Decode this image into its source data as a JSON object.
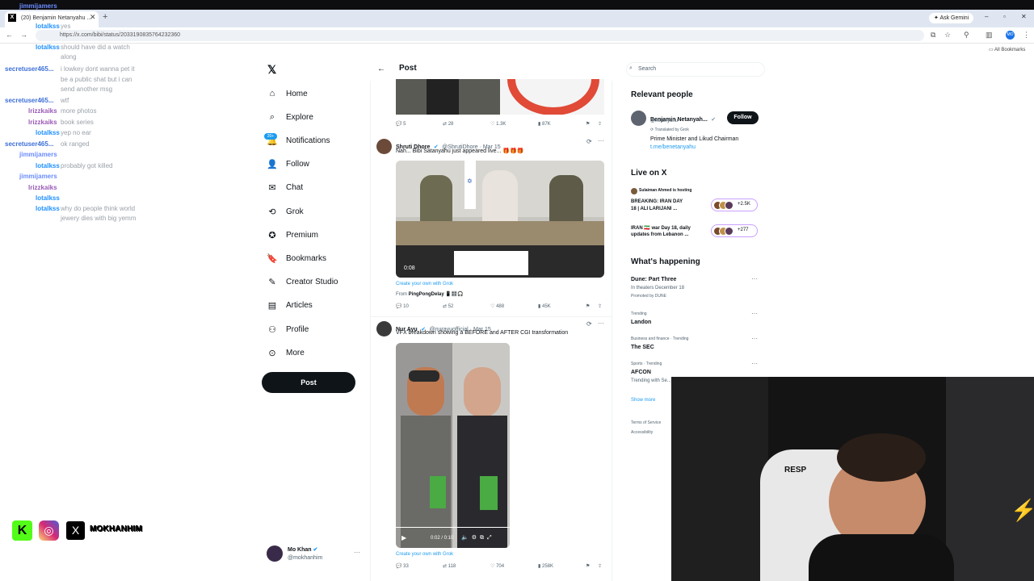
{
  "browser": {
    "tab_title": "(20) Benjamin Netanyahu ...",
    "url": "https://x.com/bibi/status/2033190835764232360",
    "ask_gemini": "Ask Gemini",
    "all_bookmarks": "All Bookmarks"
  },
  "chat": [
    {
      "user": "jimmijamers",
      "msg": "",
      "color": "#6b8cff"
    },
    {
      "user": "lotalkss",
      "msg": "yes",
      "color": "#1e90ff"
    },
    {
      "user": "lotalkss",
      "msg": "should have did a watch",
      "color": "#1e90ff"
    },
    {
      "user": "",
      "msg": "along",
      "color": "#1e90ff"
    },
    {
      "user": "secretuser465...",
      "msg": "i lowkey dont wanna pet it",
      "color": "#3d6fd8"
    },
    {
      "user": "",
      "msg": "be a public shat but i can",
      "color": "#3d6fd8"
    },
    {
      "user": "",
      "msg": "send another msg",
      "color": "#3d6fd8"
    },
    {
      "user": "secretuser465...",
      "msg": "wtf",
      "color": "#3d6fd8"
    },
    {
      "user": "lrizzkaiks",
      "msg": "more photos",
      "color": "#9b59b6"
    },
    {
      "user": "lrizzkaiks",
      "msg": "book series",
      "color": "#9b59b6"
    },
    {
      "user": "lotalkss",
      "msg": "yep no ear",
      "color": "#1e90ff"
    },
    {
      "user": "secretuser465...",
      "msg": "ok ranged",
      "color": "#3d6fd8"
    },
    {
      "user": "jimmijamers",
      "msg": "",
      "color": "#6b8cff"
    },
    {
      "user": "lotalkss",
      "msg": "probably got killed",
      "color": "#1e90ff"
    },
    {
      "user": "jimmijamers",
      "msg": "",
      "color": "#6b8cff"
    },
    {
      "user": "lrizzkaiks",
      "msg": "",
      "color": "#9b59b6"
    },
    {
      "user": "lotalkss",
      "msg": "",
      "color": "#1e90ff"
    },
    {
      "user": "lotalkss",
      "msg": "why do people think world",
      "color": "#1e90ff"
    },
    {
      "user": "",
      "msg": "jewery dies with big yemm",
      "color": "#1e90ff"
    }
  ],
  "socials": {
    "handle": "MOKHANHIM"
  },
  "nav": {
    "items": [
      "Home",
      "Explore",
      "Notifications",
      "Follow",
      "Chat",
      "Grok",
      "Premium",
      "Bookmarks",
      "Creator Studio",
      "Articles",
      "Profile",
      "More"
    ],
    "notif_badge": "20+",
    "post_button": "Post"
  },
  "account": {
    "name": "Mo Khan",
    "handle": "@mokhanhim"
  },
  "feed": {
    "header": "Post",
    "top_post_stats": {
      "replies": "5",
      "reposts": "28",
      "likes": "1.3K",
      "views": "87K"
    },
    "tweet1": {
      "name": "Shruti Dhore",
      "meta": "@ShrutiDhore · Mar 15",
      "text": "Nah... Bibi Satanyahu just appeared live... 🎁🎁🎁",
      "video_time": "0:08",
      "grok_prompt": "Create your own with Grok",
      "from_label": "From",
      "from_name": "PingPongDelay",
      "stats": {
        "replies": "10",
        "reposts": "52",
        "likes": "488",
        "views": "45K"
      }
    },
    "tweet2": {
      "name": "Nur Ayu",
      "meta": "@nurayuofficial · Mar 15",
      "text": "VFX breakdown showing a BEFORE and AFTER CGI transformation",
      "video_time": "0:02 / 0:10",
      "grok_prompt": "Create your own with Grok",
      "stats": {
        "replies": "33",
        "reposts": "118",
        "likes": "704",
        "views": "258K"
      }
    }
  },
  "right": {
    "search_placeholder": "Search",
    "relevant_title": "Relevant people",
    "person": {
      "name": "Benjamin Netanyah...",
      "handle": "@netanyahu",
      "translated": "Translated by Grok",
      "bio": "Prime Minister and Likud Chairman",
      "link": "t.me/benetanyahu",
      "follow": "Follow"
    },
    "live_title": "Live on X",
    "live_host": "Sulaiman Ahmed is hosting",
    "live_items": [
      {
        "text1": "BREAKING: IRAN DAY",
        "text2": "18 | ALI LARIJANI ...",
        "count": "+2.5K"
      },
      {
        "text1": "IRAN 🇮🇷 war Day 18, daily",
        "text2": "updates from Lebanon ...",
        "count": "+277"
      }
    ],
    "happening_title": "What's happening",
    "trends": [
      {
        "ctx": "",
        "name": "Dune: Part Three",
        "sub1": "In theaters December 18",
        "sub2": "Promoted by DUNE"
      },
      {
        "ctx": "Trending",
        "name": "Landon",
        "sub1": "",
        "sub2": ""
      },
      {
        "ctx": "Business and finance · Trending",
        "name": "The SEC",
        "sub1": "",
        "sub2": ""
      },
      {
        "ctx": "Sports · Trending",
        "name": "AFCON",
        "sub1": "Trending with Se...",
        "sub2": ""
      }
    ],
    "show_more": "Show more",
    "footer1": "Terms of Service",
    "footer2": "Accessibility"
  },
  "colors": {
    "accent": "#1d9bf0",
    "text": "#0f1419",
    "muted": "#536471"
  }
}
